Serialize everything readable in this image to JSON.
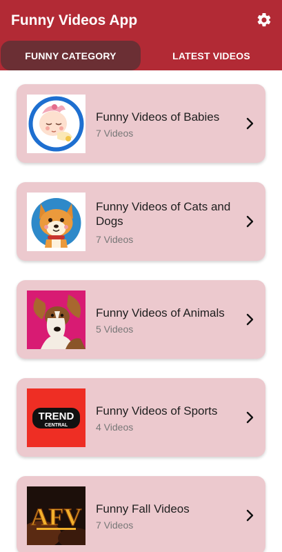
{
  "app": {
    "title": "Funny Videos App",
    "settings_icon": "gear-icon",
    "accent_color": "#b22a35",
    "active_tab_color": "#6b2f34",
    "card_color": "#ecc9ce"
  },
  "tabs": [
    {
      "label": "FUNNY CATEGORY",
      "active": true
    },
    {
      "label": "LATEST VIDEOS",
      "active": false
    }
  ],
  "categories": [
    {
      "title": "Funny Videos of Babies",
      "count": "7 Videos",
      "thumb": "baby-thumbnail"
    },
    {
      "title": "Funny Videos of Cats and Dogs",
      "count": "7 Videos",
      "thumb": "dog-thumbnail"
    },
    {
      "title": "Funny Videos of Animals",
      "count": "5 Videos",
      "thumb": "beagle-thumbnail"
    },
    {
      "title": "Funny Videos of Sports",
      "count": "4 Videos",
      "thumb": "trend-central-thumbnail",
      "logo_text": [
        "TREND",
        "CENTRAL"
      ]
    },
    {
      "title": "Funny Fall Videos",
      "count": "7 Videos",
      "thumb": "afv-thumbnail",
      "logo_text": [
        "AFV"
      ]
    }
  ]
}
